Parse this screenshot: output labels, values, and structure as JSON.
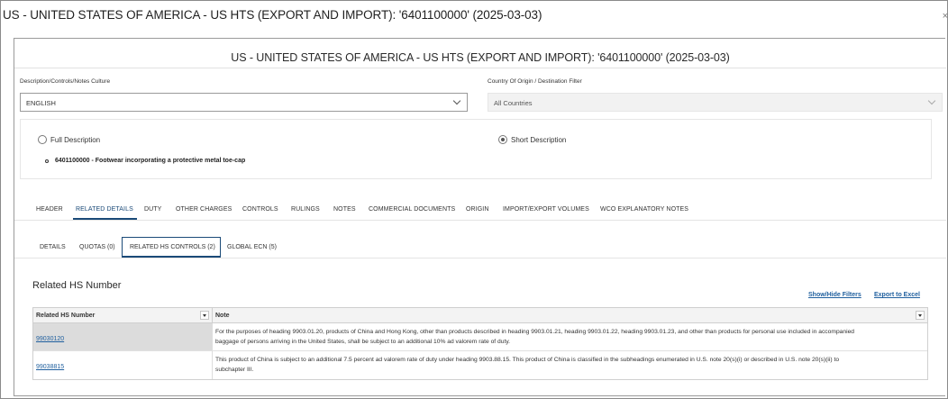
{
  "window": {
    "title": "US - UNITED STATES OF AMERICA - US HTS (EXPORT AND IMPORT): '6401100000' (2025-03-03)",
    "close": "×"
  },
  "page": {
    "title": "US - UNITED STATES OF AMERICA - US HTS (EXPORT AND IMPORT): '6401100000' (2025-03-03)"
  },
  "culture": {
    "label": "Description/Controls/Notes Culture",
    "value": "ENGLISH"
  },
  "origin_filter": {
    "label": "Country Of Origin / Destination Filter",
    "value": "All Countries"
  },
  "description_mode": {
    "full_label": "Full Description",
    "short_label": "Short Description",
    "selected": "short"
  },
  "description_item": {
    "code": "6401100000",
    "text": "6401100000 - Footwear incorporating a protective metal toe-cap"
  },
  "main_tabs": [
    {
      "label": "HEADER"
    },
    {
      "label": "RELATED DETAILS"
    },
    {
      "label": "DUTY"
    },
    {
      "label": "OTHER CHARGES"
    },
    {
      "label": "CONTROLS"
    },
    {
      "label": "RULINGS"
    },
    {
      "label": "NOTES"
    },
    {
      "label": "COMMERCIAL DOCUMENTS"
    },
    {
      "label": "ORIGIN"
    },
    {
      "label": "IMPORT/EXPORT VOLUMES"
    },
    {
      "label": "WCO EXPLANATORY NOTES"
    }
  ],
  "main_tab_active": "RELATED DETAILS",
  "sub_tabs": [
    {
      "label": "DETAILS"
    },
    {
      "label": "QUOTAS (0)"
    },
    {
      "label": "RELATED HS CONTROLS (2)"
    },
    {
      "label": "GLOBAL ECN (5)"
    }
  ],
  "sub_tab_active": "RELATED HS CONTROLS (2)",
  "section": {
    "title": "Related HS Number",
    "show_hide_filters": "Show/Hide Filters",
    "export_excel": "Export to Excel"
  },
  "table": {
    "columns": [
      "Related HS Number",
      "Note"
    ],
    "rows": [
      {
        "hs": "99030120",
        "note_line1": "For the purposes of heading 9903.01.20, products of China and Hong Kong, other than products described in heading 9903.01.21, heading 9903.01.22, heading 9903.01.23, and other than products for personal use included in accompanied",
        "note_line2": "baggage of persons arriving in the United States, shall be subject to an additional 10% ad valorem rate of duty."
      },
      {
        "hs": "99038815",
        "note_line1": "This product of China is subject to an additional 7.5 percent ad valorem rate of duty under heading 9903.88.15. This product of China is classified in the subheadings enumerated in U.S. note 20(s)(i) or described in U.S. note 20(s)(ii) to",
        "note_line2": "subchapter III."
      }
    ]
  }
}
